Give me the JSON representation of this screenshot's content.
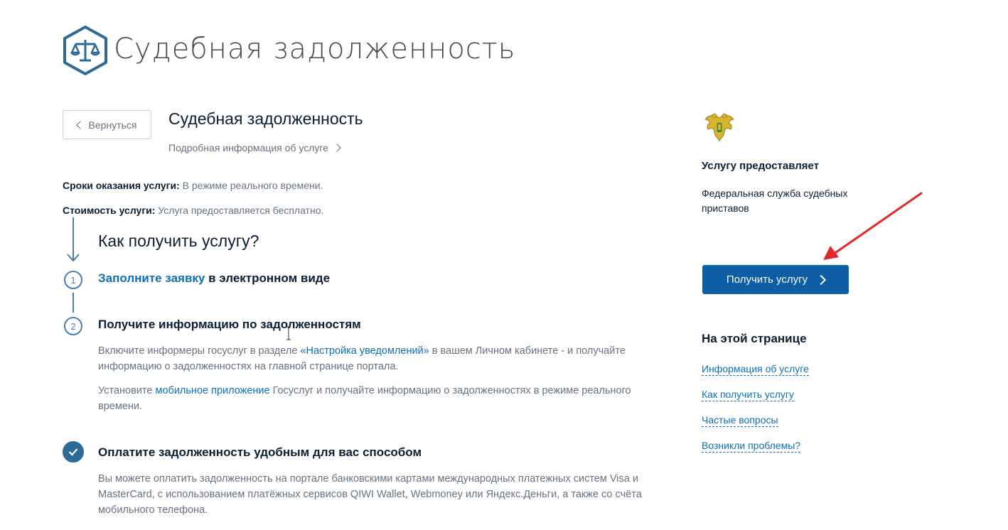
{
  "header": {
    "title": "Судебная задолженность",
    "logo_icon": "scales-icon"
  },
  "back_button": {
    "label": "Вернуться",
    "icon": "chevron-left-icon"
  },
  "service": {
    "title": "Судебная задолженность",
    "details_link": "Подробная информация об услуге"
  },
  "meta": {
    "terms_label": "Сроки оказания услуги:",
    "terms_value": "В режиме реального времени.",
    "cost_label": "Стоимость услуги:",
    "cost_value": "Услуга предоставляется бесплатно."
  },
  "how": {
    "heading": "Как получить услугу?",
    "step1": {
      "number": "1",
      "link": "Заполните заявку",
      "rest": "в электронном виде"
    },
    "step2": {
      "number": "2",
      "title": "Получите информацию по задолженностям",
      "p1_before": "Включите информеры госуслуг в разделе",
      "p1_link": "«Настройка уведомлений»",
      "p1_after": "в вашем Личном кабинете - и получайте информацию о задолженностях на главной странице портала.",
      "p2_before": "Установите",
      "p2_link": "мобильное приложение",
      "p2_after": "Госуслуг и получайте информацию о задолженностях в режиме реального времени."
    },
    "step3": {
      "icon": "checkmark-icon",
      "title": "Оплатите задолженность удобным для вас способом",
      "text": "Вы можете оплатить задолженность на портале банковскими картами международных платежных систем Visa и MasterCard, с использованием платёжных сервисов QIWI Wallet, Webmoney или Яндекс.Деньги, а также со счёта мобильного телефона."
    }
  },
  "provider": {
    "emblem_icon": "double-headed-eagle-emblem-icon",
    "heading": "Услугу предоставляет",
    "name": "Федеральная служба судебных приставов"
  },
  "get_service_button": {
    "label": "Получить услугу"
  },
  "on_this_page": {
    "heading": "На этой странице",
    "links": [
      "Информация об услуге",
      "Как получить услугу",
      "Частые вопросы",
      "Возникли проблемы?"
    ]
  },
  "colors": {
    "accent": "#0d5ea5",
    "link": "#0d6fb8",
    "annotation_arrow": "#e3262a",
    "timeline": "#2d6a98"
  }
}
